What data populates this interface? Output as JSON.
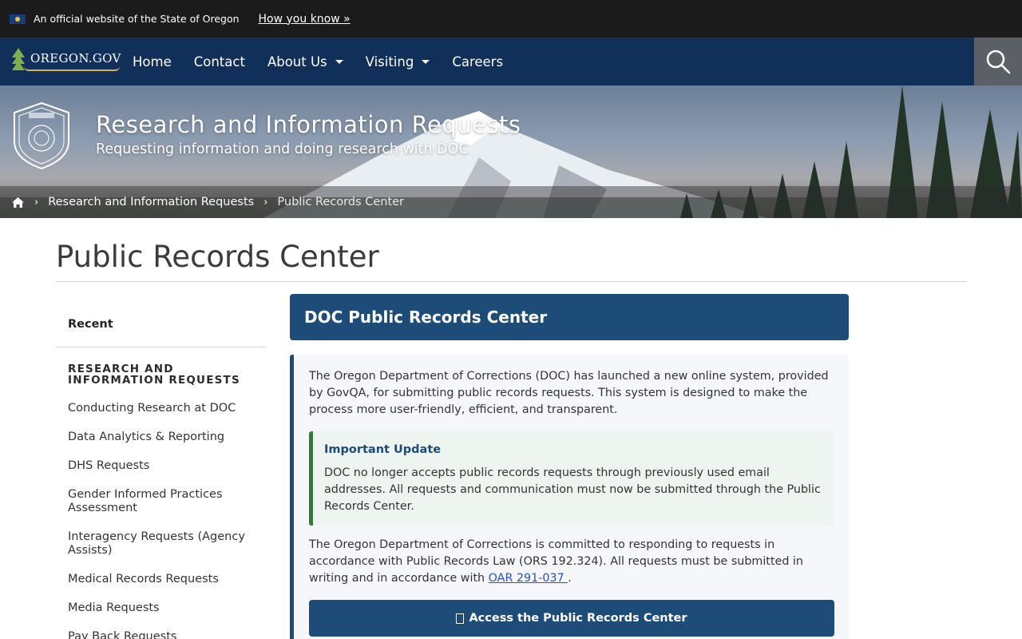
{
  "official_bar": {
    "text": "An official website of the State of Oregon",
    "link": "How you know »"
  },
  "navbar": {
    "logo_text": "OREGON.GOV",
    "items": [
      {
        "label": "Home",
        "has_dropdown": false
      },
      {
        "label": "Contact",
        "has_dropdown": false
      },
      {
        "label": "About Us",
        "has_dropdown": true
      },
      {
        "label": "Visiting",
        "has_dropdown": true
      },
      {
        "label": "Careers",
        "has_dropdown": false
      }
    ],
    "search_icon": "search-icon"
  },
  "hero": {
    "title": "Research and Information Requests",
    "subtitle": "Requesting information and doing research with DOC",
    "breadcrumb": {
      "home_icon": "home-icon",
      "items": [
        "Research and Information Requests",
        "Public Records Center"
      ]
    }
  },
  "page": {
    "title": "Public Records Center"
  },
  "sidebar": {
    "recent": "Recent",
    "heading": "RESEARCH AND INFORMATION REQUESTS",
    "links": [
      "Conducting Research at DOC",
      "Data Analytics & Reporting",
      "DHS Requests",
      "Gender Informed Practices Assessment",
      "Interagency Requests (Agency Assists)",
      "Medical Records Requests",
      "Media Requests",
      "Pay Back Requests"
    ]
  },
  "main": {
    "header": "DOC Public Records Center",
    "intro": "The Oregon Department of Corrections (DOC) has launched a new online system, provided by GovQA, for submitting public records requests. This system is designed to make the process more user-friendly, efficient, and transparent.",
    "update": {
      "title": "Important Update",
      "text": "DOC no longer accepts public records requests through previously used email addresses. All requests and communication must now be submitted through the Public Records Center."
    },
    "commitment_text": "The Oregon Department of Corrections is committed to responding to requests in accordance with Public Records Law (ORS 192.324). All requests must be submitted in writing and in accordance with ",
    "commitment_link": "OAR 291-037 ",
    "commitment_end": ".",
    "access_button": "Access the Public Records Center"
  },
  "colors": {
    "navbar": "#10305a",
    "official_bar": "#1b1b1b",
    "primary": "#1e4c79",
    "update_accent": "#2e7d32",
    "link": "#2b4fc7"
  }
}
